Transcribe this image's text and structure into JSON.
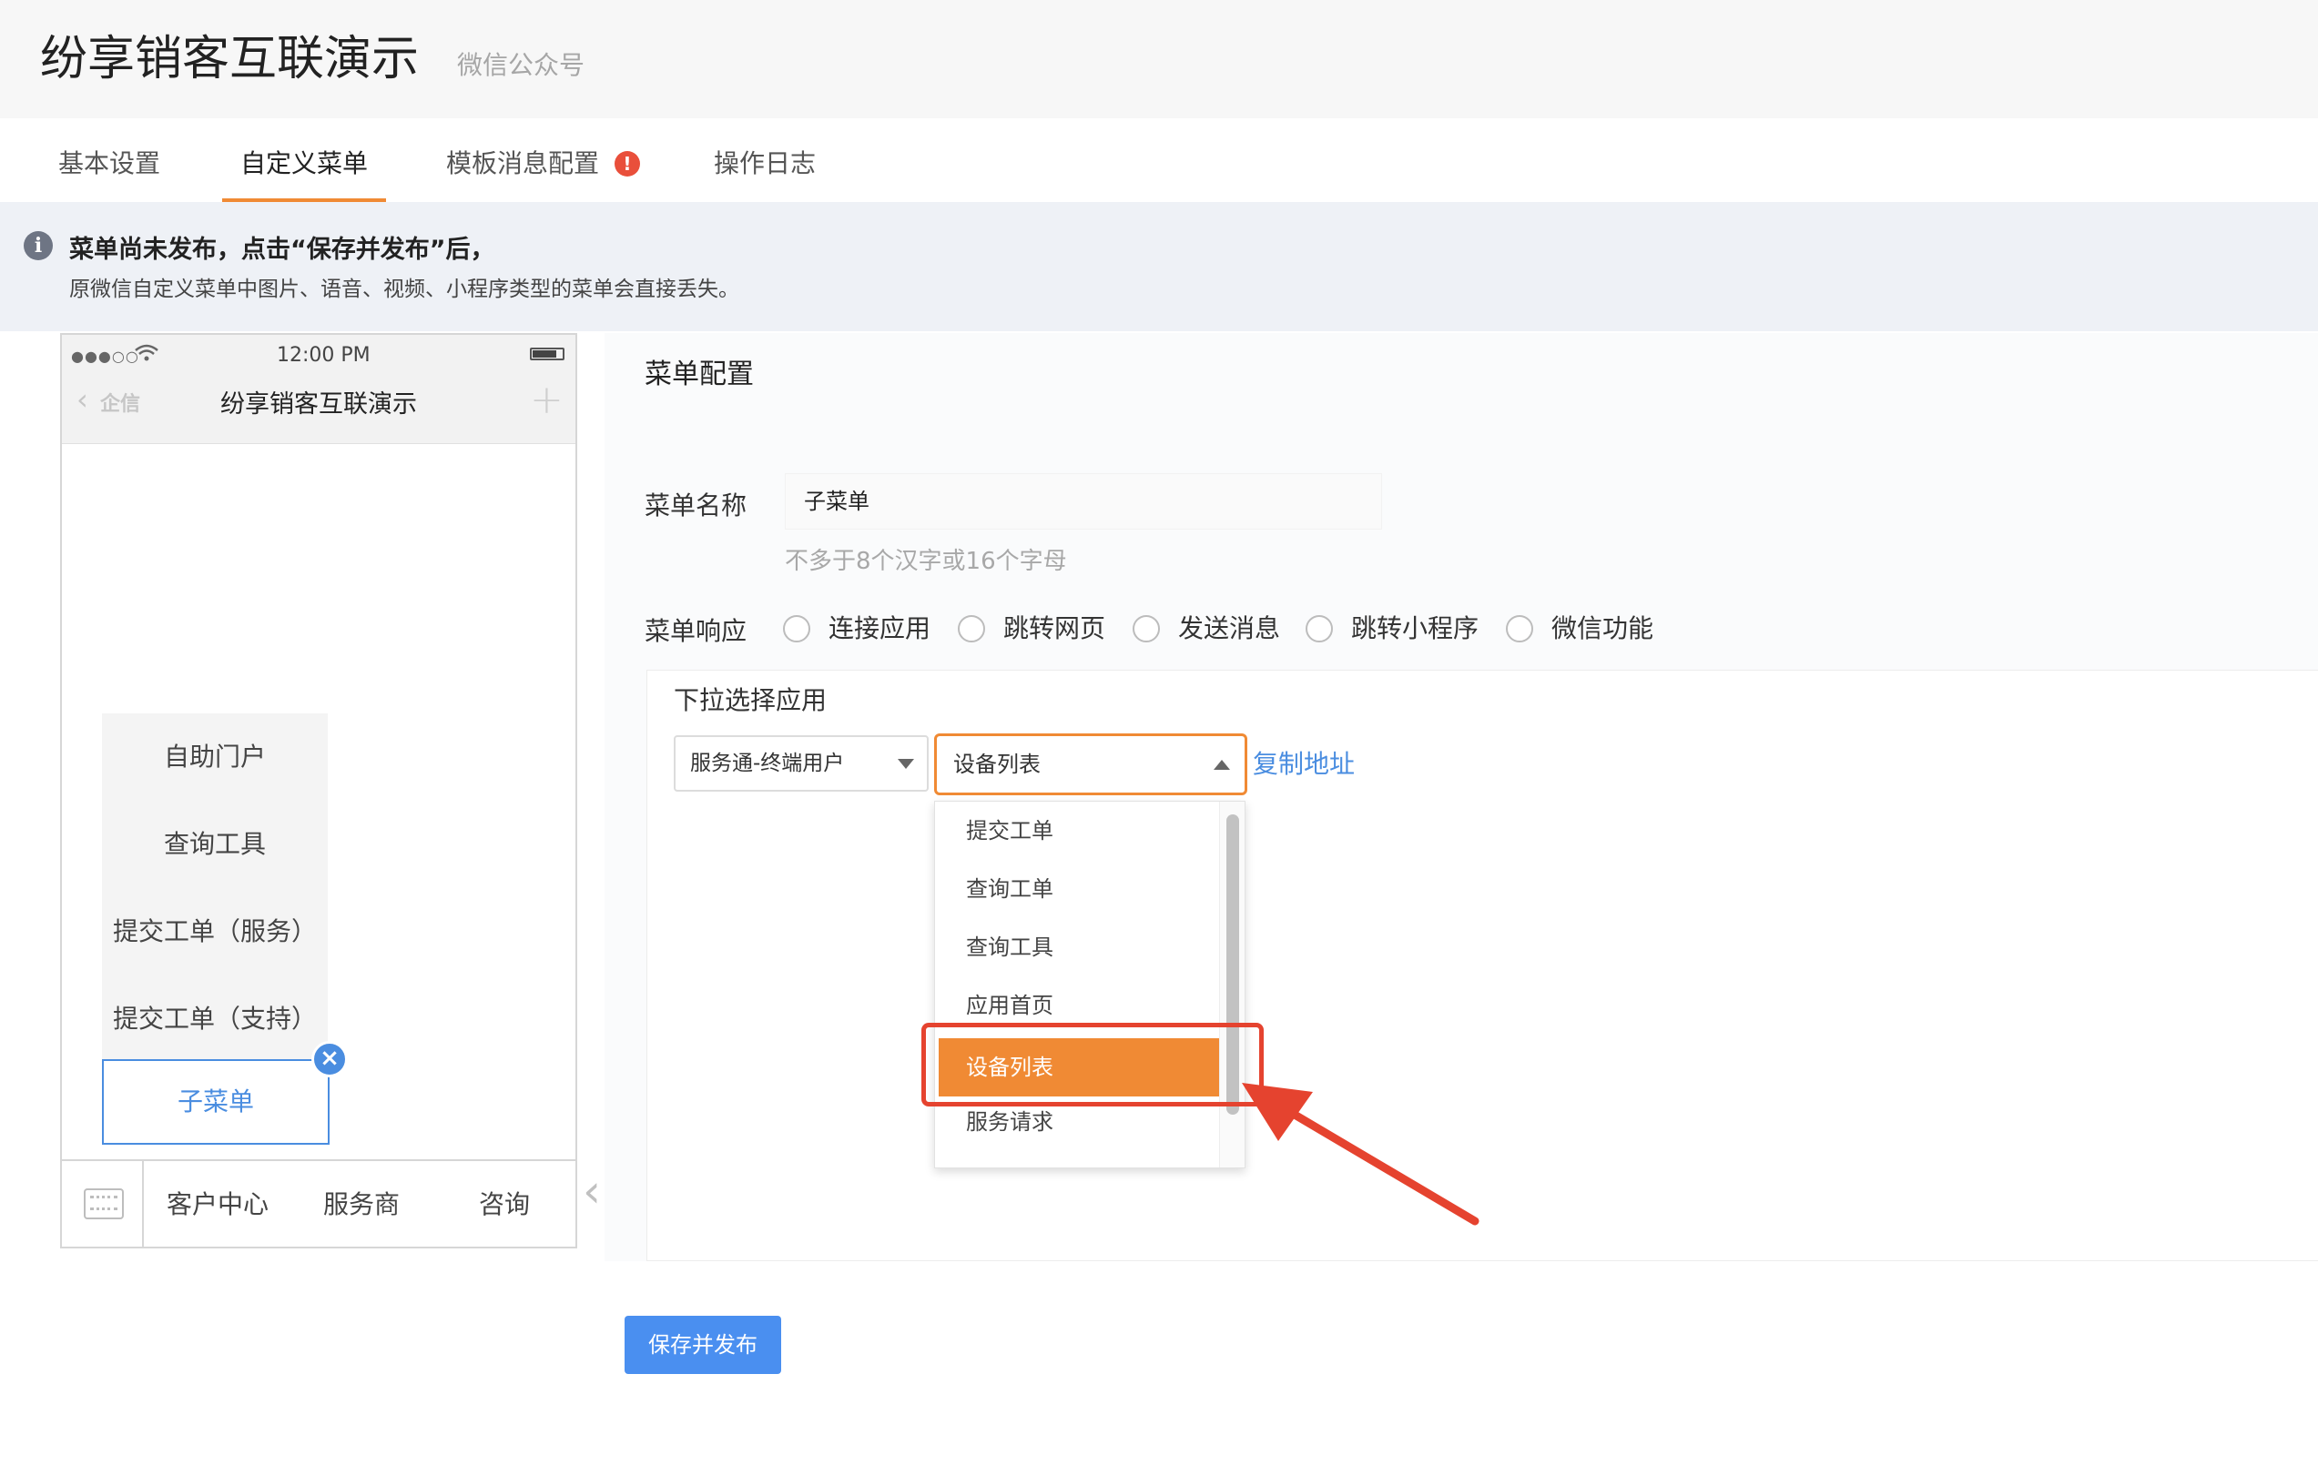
{
  "header": {
    "title": "纷享销客互联演示",
    "subtitle": "微信公众号"
  },
  "tabs": [
    {
      "label": "基本设置"
    },
    {
      "label": "自定义菜单",
      "active": true
    },
    {
      "label": "模板消息配置",
      "badge": "!"
    },
    {
      "label": "操作日志"
    }
  ],
  "notice": {
    "title": "菜单尚未发布，点击“保存并发布”后，",
    "description": "原微信自定义菜单中图片、语音、视频、小程序类型的菜单会直接丢失。"
  },
  "phone": {
    "signal": "●●●○○",
    "time": "12:00 PM",
    "back_label": "企信",
    "title": "纷享销客互联演示",
    "submenu": [
      "自助门户",
      "查询工具",
      "提交工单（服务）",
      "提交工单（支持）"
    ],
    "active_submenu": "子菜单",
    "bottom_menu": [
      "客户中心",
      "服务商",
      "咨询"
    ]
  },
  "config": {
    "section_title": "菜单配置",
    "name_label": "菜单名称",
    "name_value": "子菜单",
    "name_hint": "不多于8个汉字或16个字母",
    "response_label": "菜单响应",
    "response_options": [
      "连接应用",
      "跳转网页",
      "发送消息",
      "跳转小程序",
      "微信功能"
    ],
    "app_select_label": "下拉选择应用",
    "app_select_value": "服务通-终端用户",
    "page_select_value": "设备列表",
    "copy_link": "复制地址",
    "dropdown_options": [
      "提交工单",
      "查询工单",
      "查询工具",
      "应用首页",
      "设备列表",
      "服务请求"
    ],
    "dropdown_selected": "设备列表"
  },
  "save_button": "保存并发布",
  "colors": {
    "accent": "#f08a34",
    "link": "#4a8de0",
    "primary_button": "#4a8ff0",
    "annotation_red": "#e5432f"
  }
}
